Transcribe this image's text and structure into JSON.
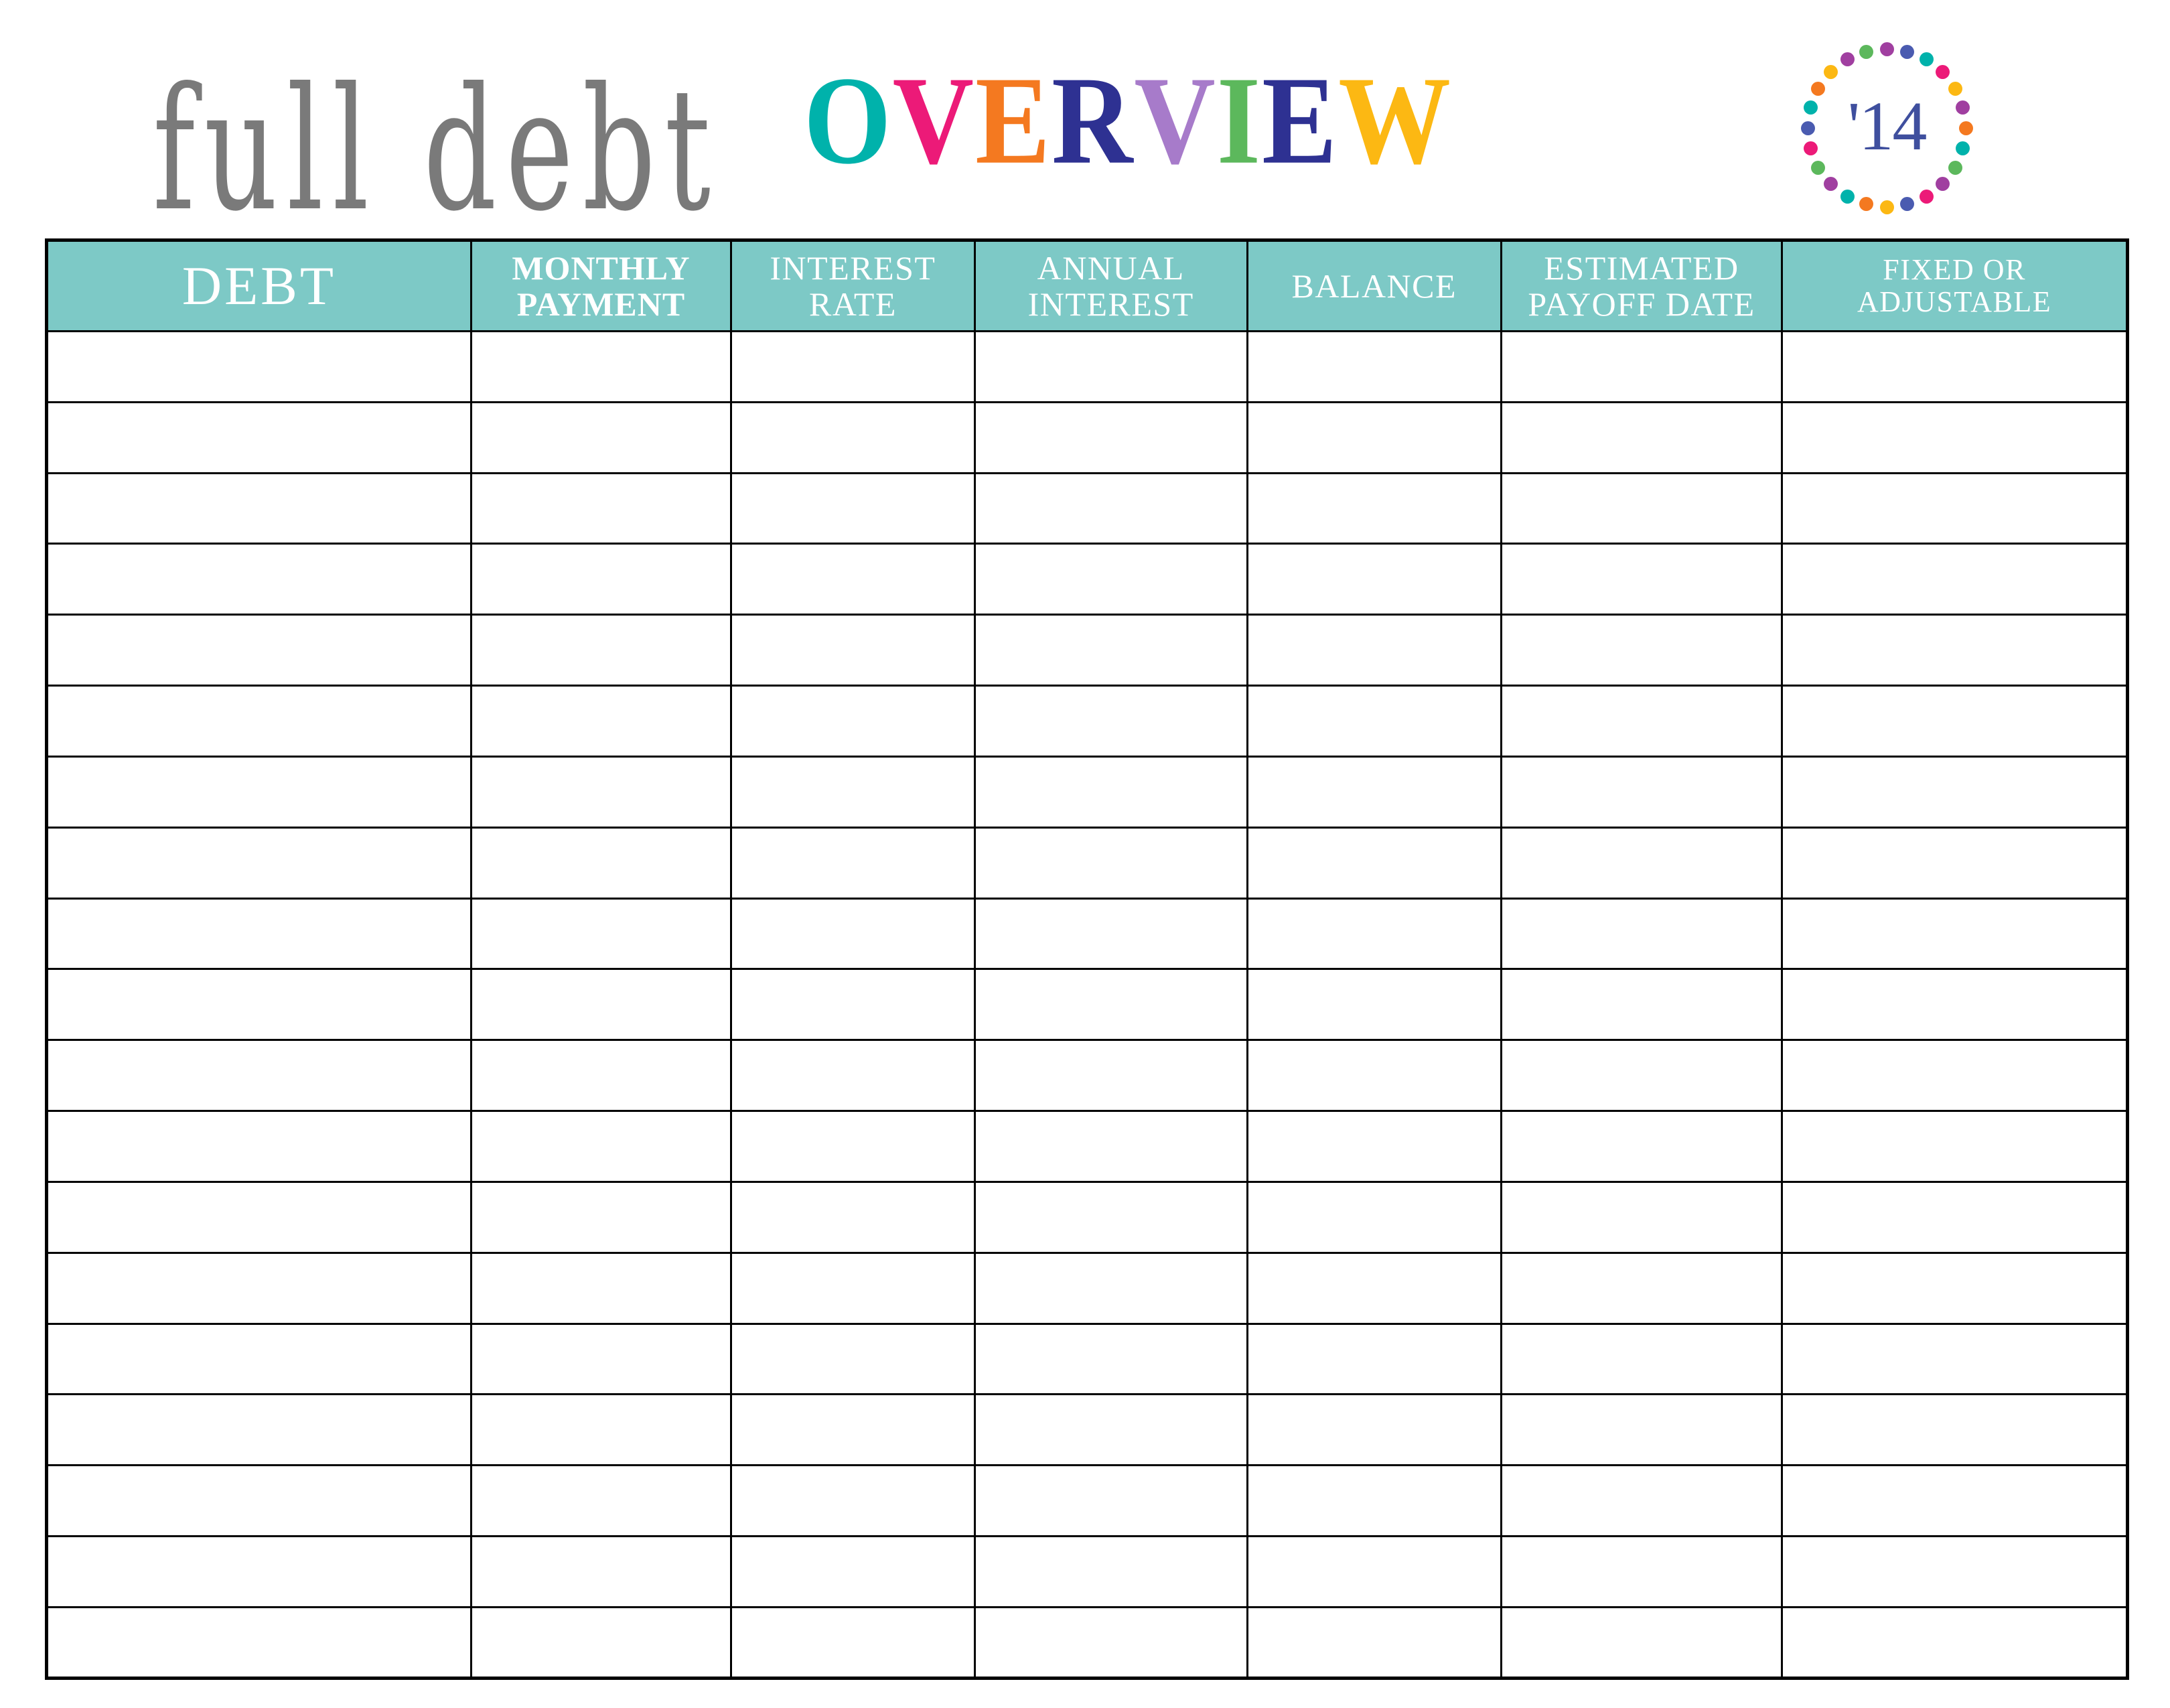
{
  "page": {
    "background": "#ffffff",
    "accent_teal": "#7dc9c6",
    "grid_color": "#000000"
  },
  "header": {
    "title_script": "full debt",
    "title_word": "OVERVIEW",
    "title_letters": [
      {
        "char": "O",
        "color": "#00b2ab"
      },
      {
        "char": "V",
        "color": "#ec1a78"
      },
      {
        "char": "E",
        "color": "#f47920"
      },
      {
        "char": "R",
        "color": "#2e3192"
      },
      {
        "char": "V",
        "color": "#a77bca"
      },
      {
        "char": "I",
        "color": "#5cb85c"
      },
      {
        "char": "E",
        "color": "#2e3192"
      },
      {
        "char": "W",
        "color": "#fcb813"
      }
    ],
    "year_badge": {
      "label": "'14",
      "label_color": "#3f4f9e",
      "dot_colors": [
        "#a03fa0",
        "#4a5bb0",
        "#00b2ab",
        "#ec1a78",
        "#fcb813",
        "#a03fa0",
        "#f47920",
        "#00b2ab",
        "#5cb85c",
        "#a03fa0",
        "#ec1a78",
        "#4a5bb0",
        "#fcb813",
        "#f47920",
        "#00b2ab",
        "#a03fa0",
        "#5cb85c",
        "#ec1a78",
        "#4a5bb0",
        "#00b2ab",
        "#f47920",
        "#fcb813",
        "#a03fa0",
        "#5cb85c"
      ]
    }
  },
  "table": {
    "columns": [
      {
        "id": "debt",
        "label": "DEBT",
        "style": "large",
        "width_pct": 20.4
      },
      {
        "id": "monthly",
        "label": "MONTHLY\nPAYMENT",
        "style": "bold",
        "width_pct": 12.5
      },
      {
        "id": "rate",
        "label": "INTEREST\nRATE",
        "style": "normal",
        "width_pct": 11.7
      },
      {
        "id": "annual",
        "label": "ANNUAL\nINTEREST",
        "style": "normal",
        "width_pct": 13.1
      },
      {
        "id": "balance",
        "label": "BALANCE",
        "style": "normal",
        "width_pct": 12.2
      },
      {
        "id": "payoff",
        "label": "ESTIMATED\nPAYOFF DATE",
        "style": "normal",
        "width_pct": 13.5
      },
      {
        "id": "fixed",
        "label": "FIXED OR\nADJUSTABLE",
        "style": "small",
        "width_pct": 16.6
      }
    ],
    "row_count": 19,
    "rows": [
      [
        "",
        "",
        "",
        "",
        "",
        "",
        ""
      ],
      [
        "",
        "",
        "",
        "",
        "",
        "",
        ""
      ],
      [
        "",
        "",
        "",
        "",
        "",
        "",
        ""
      ],
      [
        "",
        "",
        "",
        "",
        "",
        "",
        ""
      ],
      [
        "",
        "",
        "",
        "",
        "",
        "",
        ""
      ],
      [
        "",
        "",
        "",
        "",
        "",
        "",
        ""
      ],
      [
        "",
        "",
        "",
        "",
        "",
        "",
        ""
      ],
      [
        "",
        "",
        "",
        "",
        "",
        "",
        ""
      ],
      [
        "",
        "",
        "",
        "",
        "",
        "",
        ""
      ],
      [
        "",
        "",
        "",
        "",
        "",
        "",
        ""
      ],
      [
        "",
        "",
        "",
        "",
        "",
        "",
        ""
      ],
      [
        "",
        "",
        "",
        "",
        "",
        "",
        ""
      ],
      [
        "",
        "",
        "",
        "",
        "",
        "",
        ""
      ],
      [
        "",
        "",
        "",
        "",
        "",
        "",
        ""
      ],
      [
        "",
        "",
        "",
        "",
        "",
        "",
        ""
      ],
      [
        "",
        "",
        "",
        "",
        "",
        "",
        ""
      ],
      [
        "",
        "",
        "",
        "",
        "",
        "",
        ""
      ],
      [
        "",
        "",
        "",
        "",
        "",
        "",
        ""
      ],
      [
        "",
        "",
        "",
        "",
        "",
        "",
        ""
      ]
    ]
  }
}
